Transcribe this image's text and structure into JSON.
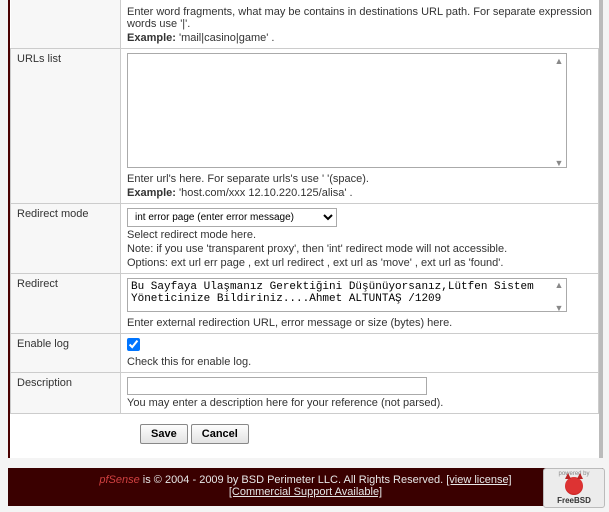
{
  "intro": {
    "hint": "Enter word fragments, what may be contains in destinations URL path. For separate expression words use '|'.",
    "example_label": "Example:",
    "example_value": "'mail|casino|game' ."
  },
  "urls": {
    "label": "URLs list",
    "value": "",
    "hint": "Enter url's here. For separate urls's use ' '(space).",
    "example_label": "Example:",
    "example_value": "'host.com/xxx 12.10.220.125/alisa' ."
  },
  "redirect_mode": {
    "label": "Redirect mode",
    "options": [
      "int error page (enter error message)"
    ],
    "selected": "int error page (enter error message)",
    "hint1": "Select redirect mode here.",
    "hint2": "Note: if you use 'transparent proxy', then 'int' redirect mode will not accessible.",
    "hint3": "Options: ext url err page , ext url redirect , ext url as 'move' , ext url as 'found'."
  },
  "redirect": {
    "label": "Redirect",
    "value": "Bu Sayfaya Ulaşmanız Gerektiğini Düşünüyorsanız,Lütfen Sistem Yöneticinize Bildiriniz....Ahmet ALTUNTAŞ /1209",
    "hint": "Enter external redirection URL, error message or size (bytes) here."
  },
  "enable_log": {
    "label": "Enable log",
    "checked": true,
    "hint": "Check this for enable log."
  },
  "description": {
    "label": "Description",
    "value": "",
    "hint": "You may enter a description here for your reference (not parsed)."
  },
  "buttons": {
    "save": "Save",
    "cancel": "Cancel"
  },
  "footer": {
    "brand": "pfSense",
    "copyright": " is © 2004 - 2009 by BSD Perimeter LLC. All Rights Reserved. ",
    "view_license": "[view license]",
    "support": "[Commercial Support Available]",
    "badge_top": "powered by",
    "badge_name": "FreeBSD"
  }
}
